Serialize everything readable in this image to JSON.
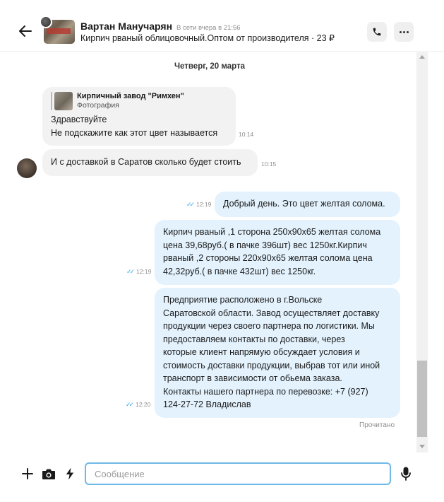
{
  "header": {
    "contact_name": "Вартан Манучарян",
    "online_status": "В сети вчера в 21:56",
    "listing_title": "Кирпич рваный облицовочный.Оптом от производителя · 23 ₽"
  },
  "chat": {
    "date_separator": "Четверг, 20 марта",
    "messages": [
      {
        "direction": "in",
        "quote_title": "Кирпичный завод \"Римхен\"",
        "quote_subtitle": "Фотография",
        "lines": [
          "Здравствуйте",
          "Не подскажите как этот цвет называется"
        ],
        "time": "10:14"
      },
      {
        "direction": "in",
        "lines": [
          "И с доставкой в Саратов сколько будет стоить"
        ],
        "time": "10:15"
      },
      {
        "direction": "out",
        "lines": [
          "Добрый день. Это цвет желтая солома."
        ],
        "time": "12:19"
      },
      {
        "direction": "out",
        "lines": [
          "Кирпич рваный ,1 сторона 250х90х65 желтая солома",
          "цена 39,68руб.( в пачке 396шт) вес 1250кг.Кирпич",
          "рваный ,2 стороны 220х90х65 желтая солома цена",
          "42,32руб.( в пачке 432шт) вес 1250кг."
        ],
        "time": "12:19"
      },
      {
        "direction": "out",
        "lines": [
          "Предприятие расположено в  г.Вольске",
          "Саратовской области. Завод осуществляет доставку",
          "продукции через своего партнера по логистики. Мы",
          "предоставляем контакты по доставки, через",
          "которые клиент напрямую обсуждает условия и",
          "стоимость доставки продукции, выбрав тот или иной",
          "транспорт в зависимости от обьема заказа.",
          "Контакты нашего партнера по перевозке: +7 (927)",
          "124-27-72  Владислав"
        ],
        "time": "12:20"
      }
    ],
    "read_status": "Прочитано"
  },
  "composer": {
    "placeholder": "Сообщение"
  },
  "colors": {
    "outgoing_bubble": "#e3f2fd",
    "incoming_bubble": "#f2f2f2",
    "read_ticks": "#35a7e8",
    "input_focus_border": "#6fb9e8"
  },
  "icons": [
    "back-arrow-icon",
    "phone-icon",
    "more-icon",
    "plus-icon",
    "camera-icon",
    "lightning-icon",
    "microphone-icon",
    "double-check-icon"
  ]
}
